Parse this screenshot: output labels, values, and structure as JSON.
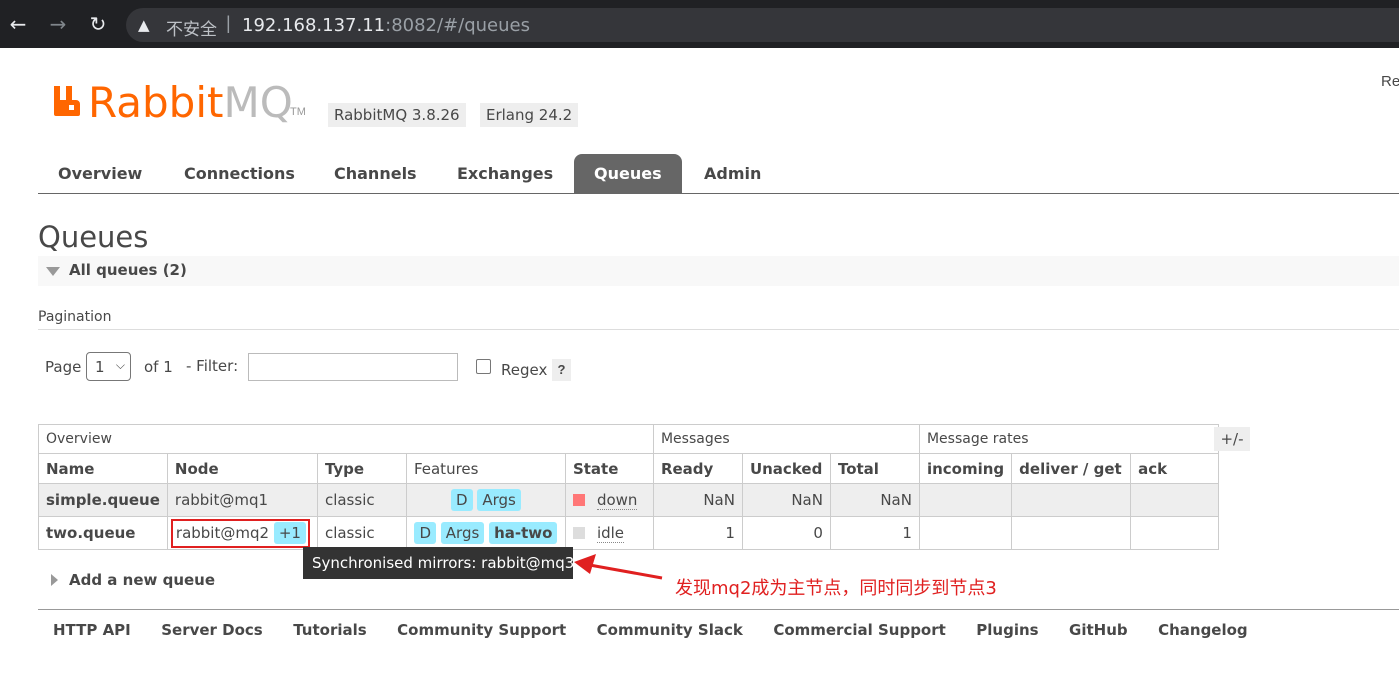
{
  "browser": {
    "back_icon": "←",
    "forward_icon": "→",
    "reload_icon": "↻",
    "warning_icon": "▲",
    "insecure_label": "不安全",
    "url_host": "192.168.137.11",
    "url_rest": ":8082/#/queues"
  },
  "header": {
    "logo_text": "Rabbit",
    "logo_text_mq": "MQ",
    "logo_tm": "TM",
    "version": "RabbitMQ 3.8.26",
    "erlang": "Erlang 24.2",
    "top_right": "Re"
  },
  "tabs": [
    {
      "label": "Overview",
      "active": false
    },
    {
      "label": "Connections",
      "active": false
    },
    {
      "label": "Channels",
      "active": false
    },
    {
      "label": "Exchanges",
      "active": false
    },
    {
      "label": "Queues",
      "active": true
    },
    {
      "label": "Admin",
      "active": false
    }
  ],
  "page": {
    "title": "Queues",
    "section_label": "All queues (2)",
    "pagination_label": "Pagination",
    "page_label": "Page",
    "page_value": "1",
    "of_label": "of 1",
    "filter_label": "- Filter:",
    "filter_value": "",
    "regex_label": "Regex",
    "help": "?",
    "plus_minus": "+/-"
  },
  "table": {
    "groups": [
      "Overview",
      "Messages",
      "Message rates"
    ],
    "columns": [
      "Name",
      "Node",
      "Type",
      "Features",
      "State",
      "Ready",
      "Unacked",
      "Total",
      "incoming",
      "deliver / get",
      "ack"
    ],
    "rows": [
      {
        "name": "simple.queue",
        "node": "rabbit@mq1",
        "node_extra": "",
        "type": "classic",
        "features": [
          "D",
          "Args"
        ],
        "state": "down",
        "state_color": "#f77",
        "ready": "NaN",
        "unacked": "NaN",
        "total": "NaN"
      },
      {
        "name": "two.queue",
        "node": "rabbit@mq2",
        "node_extra": "+1",
        "type": "classic",
        "features": [
          "D",
          "Args"
        ],
        "policy": "ha-two",
        "state": "idle",
        "state_color": "#ddd",
        "ready": "1",
        "unacked": "0",
        "total": "1"
      }
    ]
  },
  "tooltip": "Synchronised mirrors: rabbit@mq3",
  "annotation": "发现mq2成为主节点，同时同步到节点3",
  "add_queue": "Add a new queue",
  "footer": [
    "HTTP API",
    "Server Docs",
    "Tutorials",
    "Community Support",
    "Community Slack",
    "Commercial Support",
    "Plugins",
    "GitHub",
    "Changelog"
  ]
}
